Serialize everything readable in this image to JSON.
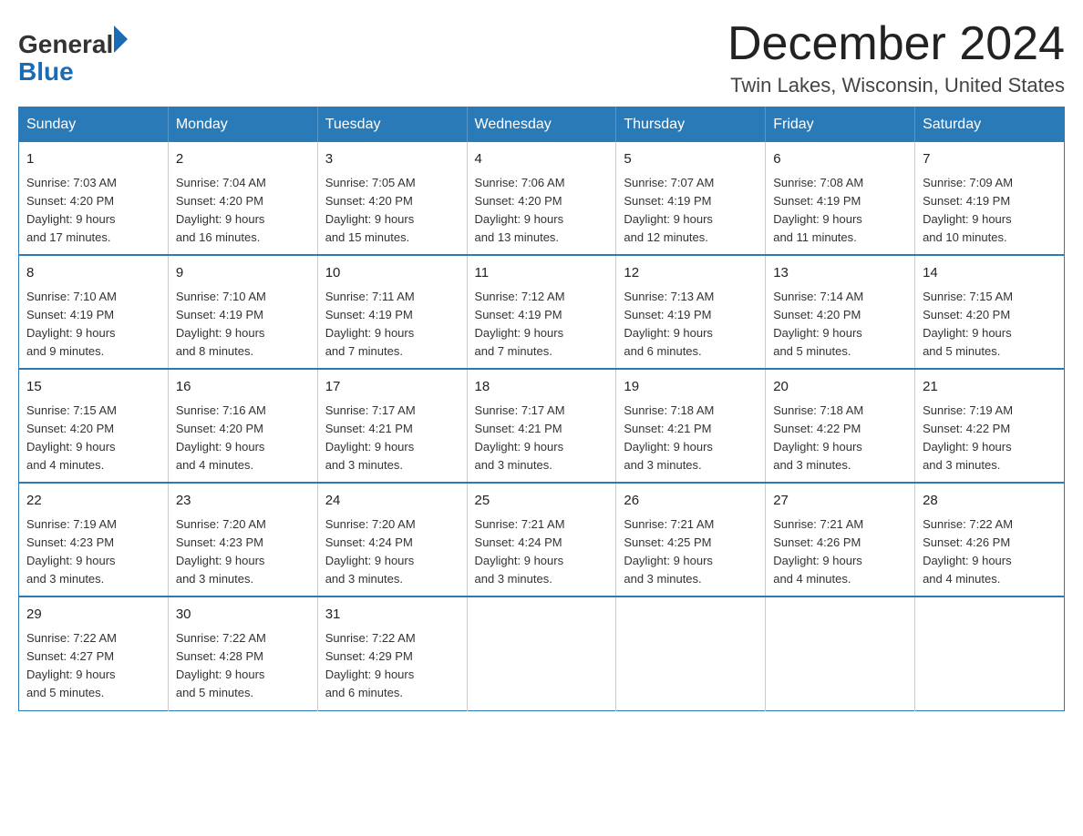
{
  "logo": {
    "general": "General",
    "blue": "Blue"
  },
  "title": {
    "month_year": "December 2024",
    "location": "Twin Lakes, Wisconsin, United States"
  },
  "weekdays": [
    "Sunday",
    "Monday",
    "Tuesday",
    "Wednesday",
    "Thursday",
    "Friday",
    "Saturday"
  ],
  "weeks": [
    [
      {
        "day": "1",
        "sunrise": "7:03 AM",
        "sunset": "4:20 PM",
        "daylight": "9 hours and 17 minutes."
      },
      {
        "day": "2",
        "sunrise": "7:04 AM",
        "sunset": "4:20 PM",
        "daylight": "9 hours and 16 minutes."
      },
      {
        "day": "3",
        "sunrise": "7:05 AM",
        "sunset": "4:20 PM",
        "daylight": "9 hours and 15 minutes."
      },
      {
        "day": "4",
        "sunrise": "7:06 AM",
        "sunset": "4:20 PM",
        "daylight": "9 hours and 13 minutes."
      },
      {
        "day": "5",
        "sunrise": "7:07 AM",
        "sunset": "4:19 PM",
        "daylight": "9 hours and 12 minutes."
      },
      {
        "day": "6",
        "sunrise": "7:08 AM",
        "sunset": "4:19 PM",
        "daylight": "9 hours and 11 minutes."
      },
      {
        "day": "7",
        "sunrise": "7:09 AM",
        "sunset": "4:19 PM",
        "daylight": "9 hours and 10 minutes."
      }
    ],
    [
      {
        "day": "8",
        "sunrise": "7:10 AM",
        "sunset": "4:19 PM",
        "daylight": "9 hours and 9 minutes."
      },
      {
        "day": "9",
        "sunrise": "7:10 AM",
        "sunset": "4:19 PM",
        "daylight": "9 hours and 8 minutes."
      },
      {
        "day": "10",
        "sunrise": "7:11 AM",
        "sunset": "4:19 PM",
        "daylight": "9 hours and 7 minutes."
      },
      {
        "day": "11",
        "sunrise": "7:12 AM",
        "sunset": "4:19 PM",
        "daylight": "9 hours and 7 minutes."
      },
      {
        "day": "12",
        "sunrise": "7:13 AM",
        "sunset": "4:19 PM",
        "daylight": "9 hours and 6 minutes."
      },
      {
        "day": "13",
        "sunrise": "7:14 AM",
        "sunset": "4:20 PM",
        "daylight": "9 hours and 5 minutes."
      },
      {
        "day": "14",
        "sunrise": "7:15 AM",
        "sunset": "4:20 PM",
        "daylight": "9 hours and 5 minutes."
      }
    ],
    [
      {
        "day": "15",
        "sunrise": "7:15 AM",
        "sunset": "4:20 PM",
        "daylight": "9 hours and 4 minutes."
      },
      {
        "day": "16",
        "sunrise": "7:16 AM",
        "sunset": "4:20 PM",
        "daylight": "9 hours and 4 minutes."
      },
      {
        "day": "17",
        "sunrise": "7:17 AM",
        "sunset": "4:21 PM",
        "daylight": "9 hours and 3 minutes."
      },
      {
        "day": "18",
        "sunrise": "7:17 AM",
        "sunset": "4:21 PM",
        "daylight": "9 hours and 3 minutes."
      },
      {
        "day": "19",
        "sunrise": "7:18 AM",
        "sunset": "4:21 PM",
        "daylight": "9 hours and 3 minutes."
      },
      {
        "day": "20",
        "sunrise": "7:18 AM",
        "sunset": "4:22 PM",
        "daylight": "9 hours and 3 minutes."
      },
      {
        "day": "21",
        "sunrise": "7:19 AM",
        "sunset": "4:22 PM",
        "daylight": "9 hours and 3 minutes."
      }
    ],
    [
      {
        "day": "22",
        "sunrise": "7:19 AM",
        "sunset": "4:23 PM",
        "daylight": "9 hours and 3 minutes."
      },
      {
        "day": "23",
        "sunrise": "7:20 AM",
        "sunset": "4:23 PM",
        "daylight": "9 hours and 3 minutes."
      },
      {
        "day": "24",
        "sunrise": "7:20 AM",
        "sunset": "4:24 PM",
        "daylight": "9 hours and 3 minutes."
      },
      {
        "day": "25",
        "sunrise": "7:21 AM",
        "sunset": "4:24 PM",
        "daylight": "9 hours and 3 minutes."
      },
      {
        "day": "26",
        "sunrise": "7:21 AM",
        "sunset": "4:25 PM",
        "daylight": "9 hours and 3 minutes."
      },
      {
        "day": "27",
        "sunrise": "7:21 AM",
        "sunset": "4:26 PM",
        "daylight": "9 hours and 4 minutes."
      },
      {
        "day": "28",
        "sunrise": "7:22 AM",
        "sunset": "4:26 PM",
        "daylight": "9 hours and 4 minutes."
      }
    ],
    [
      {
        "day": "29",
        "sunrise": "7:22 AM",
        "sunset": "4:27 PM",
        "daylight": "9 hours and 5 minutes."
      },
      {
        "day": "30",
        "sunrise": "7:22 AM",
        "sunset": "4:28 PM",
        "daylight": "9 hours and 5 minutes."
      },
      {
        "day": "31",
        "sunrise": "7:22 AM",
        "sunset": "4:29 PM",
        "daylight": "9 hours and 6 minutes."
      },
      null,
      null,
      null,
      null
    ]
  ],
  "labels": {
    "sunrise": "Sunrise:",
    "sunset": "Sunset:",
    "daylight": "Daylight:"
  },
  "colors": {
    "header_bg": "#2a7ab8",
    "header_text": "#ffffff",
    "border": "#2a7ab8"
  }
}
